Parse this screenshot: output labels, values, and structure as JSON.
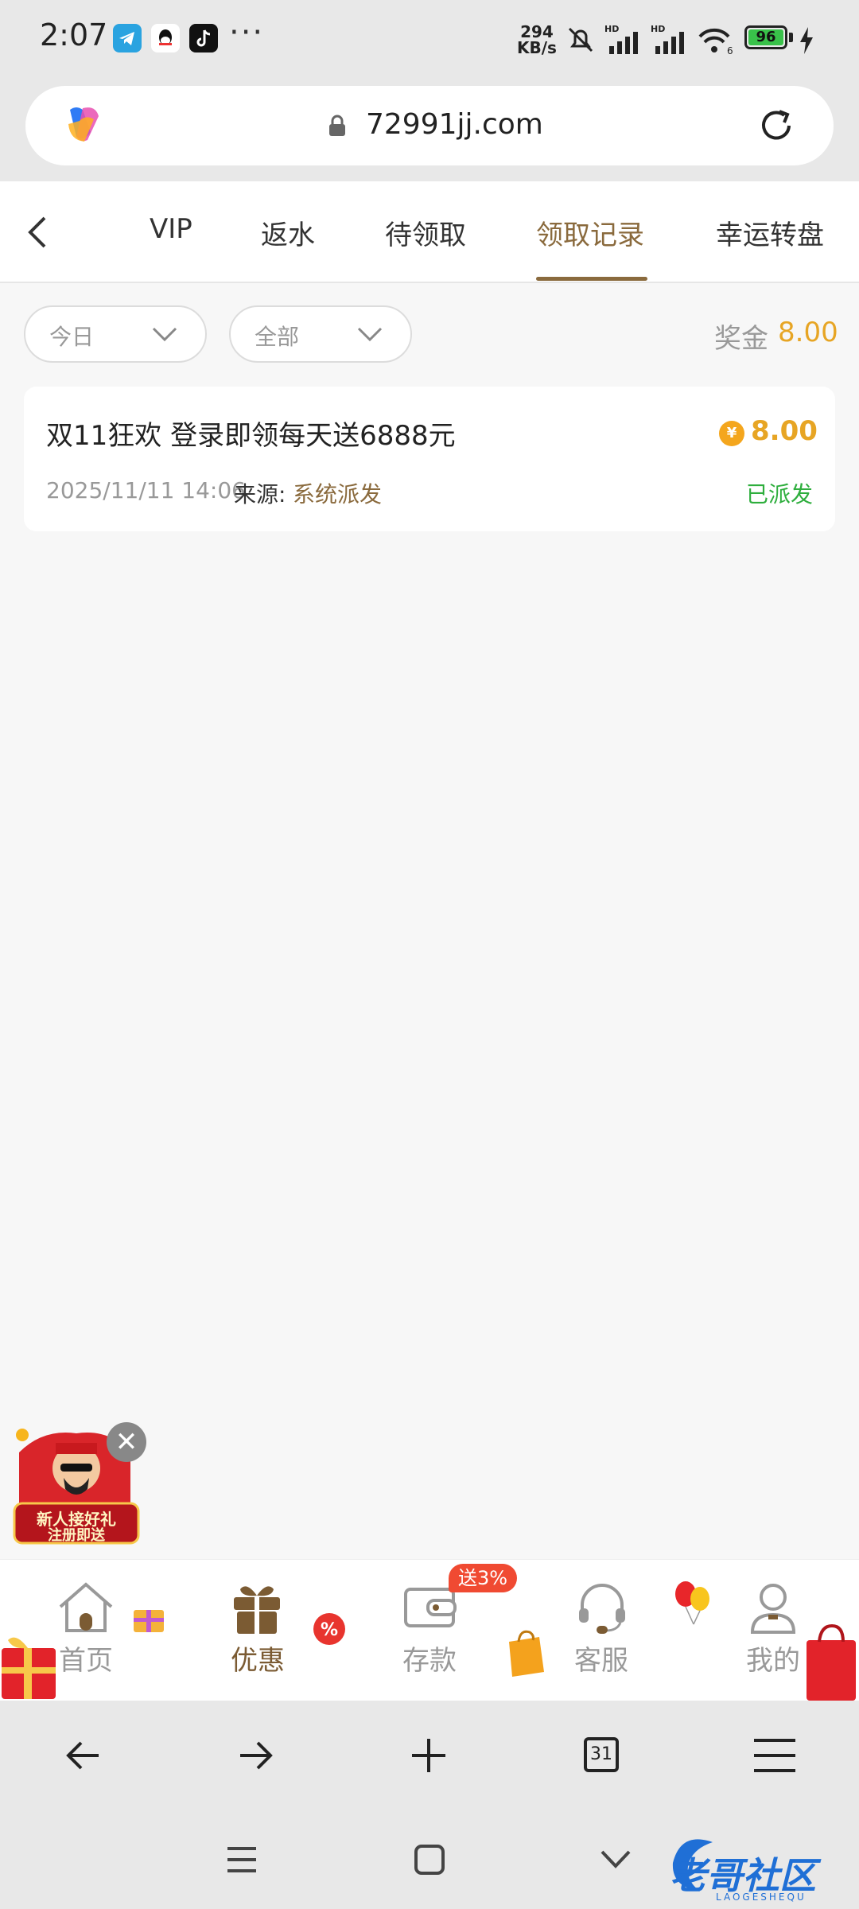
{
  "status_bar": {
    "time": "2:07",
    "more": "···",
    "net_speed_value": "294",
    "net_speed_unit": "KB/s",
    "battery": "96"
  },
  "browser": {
    "url": "72991jj.com"
  },
  "header": {
    "tabs": [
      "VIP",
      "返水",
      "待领取",
      "领取记录",
      "幸运转盘"
    ],
    "active_tab": "领取记录"
  },
  "filters": {
    "date": "今日",
    "type": "全部",
    "bonus_label": "奖金",
    "bonus_value": "8.00"
  },
  "records": [
    {
      "title": "双11狂欢 登录即领每天送6888元",
      "currency": "¥",
      "amount": "8.00",
      "date": "2025/11/11 14:06",
      "source_label": "来源:",
      "source_value": "系统派发",
      "status": "已派发"
    }
  ],
  "promo": {
    "line1": "新人接好礼",
    "line2": "注册即送"
  },
  "bottom_nav": {
    "items": [
      "首页",
      "优惠",
      "存款",
      "客服",
      "我的"
    ],
    "active": "优惠",
    "deposit_badge": "送3%"
  },
  "browser_toolbar": {
    "tab_count": "31"
  },
  "watermark": {
    "text": "老哥社区",
    "sub": "LAOGESHEQU"
  },
  "colors": {
    "accent_brown": "#8a6a3d",
    "amount_gold": "#e7a524",
    "status_green": "#2eae3d",
    "badge_red": "#f04a32"
  }
}
